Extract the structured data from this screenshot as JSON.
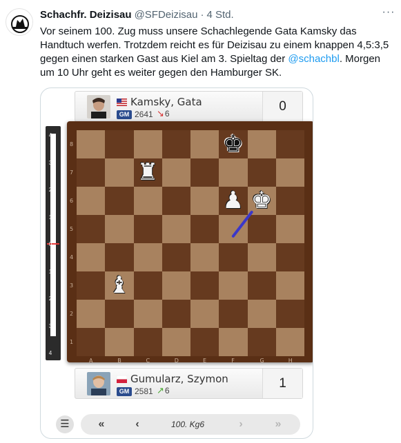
{
  "tweet": {
    "display_name": "Schachfr. Deizisau",
    "handle": "@SFDeizisau",
    "separator": "·",
    "time": "4 Std.",
    "more_icon": "more-icon",
    "avatar_text": "SCHACH",
    "text_part1": "Vor seinem 100. Zug muss unsere Schachlegende Gata Kamsky das Handtuch werfen. Trotzdem reicht es für Deizisau zu einem knappen 4,5:3,5 gegen einen starken Gast aus Kiel am 3. Spieltag der ",
    "mention": "@schachbl",
    "text_part2": ". Morgen um 10 Uhr geht es weiter gegen den Hamburger SK."
  },
  "players": {
    "top": {
      "name": "Kamsky, Gata",
      "title": "GM",
      "rating": "2641",
      "delta": "6",
      "delta_direction": "down",
      "score": "0",
      "flag": "us-flag-icon"
    },
    "bottom": {
      "name": "Gumularz, Szymon",
      "title": "GM",
      "rating": "2581",
      "delta": "6",
      "delta_direction": "up",
      "score": "1",
      "flag": "pl-flag-icon"
    }
  },
  "eval_bar": {
    "ticks": [
      "4",
      "3",
      "2",
      "1",
      "0",
      "1",
      "2",
      "3",
      "4"
    ],
    "white_fraction": 0.93
  },
  "board": {
    "files": [
      "A",
      "B",
      "C",
      "D",
      "E",
      "F",
      "G",
      "H"
    ],
    "ranks": [
      "8",
      "7",
      "6",
      "5",
      "4",
      "3",
      "2",
      "1"
    ],
    "pieces": [
      {
        "square": "f8",
        "glyph": "♚",
        "color": "black",
        "name": "black-king"
      },
      {
        "square": "c7",
        "glyph": "♜",
        "color": "white",
        "name": "white-rook"
      },
      {
        "square": "f6",
        "glyph": "♟",
        "color": "white",
        "name": "white-pawn"
      },
      {
        "square": "g6",
        "glyph": "♚",
        "color": "white",
        "name": "white-king"
      },
      {
        "square": "b3",
        "glyph": "♝",
        "color": "white",
        "name": "white-bishop"
      }
    ],
    "last_move": {
      "from": "f5",
      "to": "g6"
    },
    "arrow_color": "#3b37c9"
  },
  "controls": {
    "menu_icon": "☰",
    "first": "«",
    "prev": "‹",
    "move": "100. Kg6",
    "next": "›",
    "last": "»"
  },
  "colors": {
    "light_square": "#a8825f",
    "dark_square": "#663a1f",
    "link": "#1d9bf0"
  }
}
